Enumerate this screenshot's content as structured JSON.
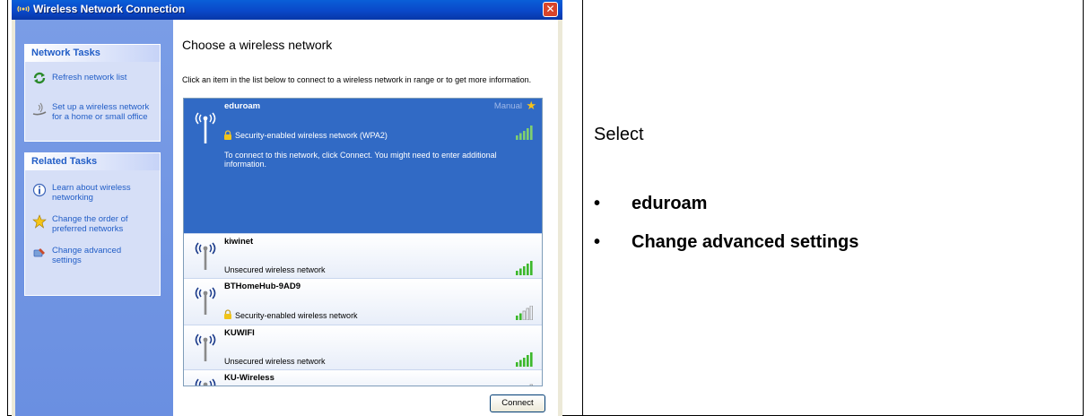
{
  "window": {
    "title": "Wireless Network Connection",
    "close_glyph": "✕"
  },
  "network_tasks": {
    "header": "Network Tasks",
    "items": [
      {
        "label": "Refresh network list",
        "icon": "refresh-icon"
      },
      {
        "label_line1": "Set up a wireless network",
        "label_line2": "for a home or small office",
        "icon": "setup-wizard-icon"
      }
    ]
  },
  "related_tasks": {
    "header": "Related Tasks",
    "items": [
      {
        "label_line1": "Learn about wireless",
        "label_line2": "networking",
        "icon": "info-icon"
      },
      {
        "label_line1": "Change the order of",
        "label_line2": "preferred networks",
        "icon": "star-icon"
      },
      {
        "label_line1": "Change advanced",
        "label_line2": "settings",
        "icon": "settings-icon"
      }
    ]
  },
  "main": {
    "title": "Choose a wireless network",
    "description": "Click an item in the list below to connect to a wireless network in range or to get more information.",
    "networks": [
      {
        "name": "eduroam",
        "security": "Security-enabled wireless network (WPA2)",
        "manual": "Manual",
        "note": "To connect to this network, click Connect. You might need to enter additional information.",
        "signal": 5,
        "selected": true
      },
      {
        "name": "kiwinet",
        "security": "Unsecured wireless network",
        "signal": 5
      },
      {
        "name": "BTHomeHub-9AD9",
        "security": "Security-enabled wireless network",
        "signal": 2
      },
      {
        "name": "KUWIFI",
        "security": "Unsecured wireless network",
        "signal": 5
      },
      {
        "name": "KU-Wireless",
        "security": "",
        "signal": 1
      }
    ],
    "connect_label": "Connect"
  },
  "doc": {
    "select_label": "Select",
    "bullets": [
      "eduroam",
      "Change advanced settings"
    ],
    "bullet_glyph": "•"
  },
  "colors": {
    "titlebar": "#0a48c9",
    "task_pane": "#6a8fe1",
    "selection": "#316ac5",
    "signal_green": "#3cb82b"
  }
}
